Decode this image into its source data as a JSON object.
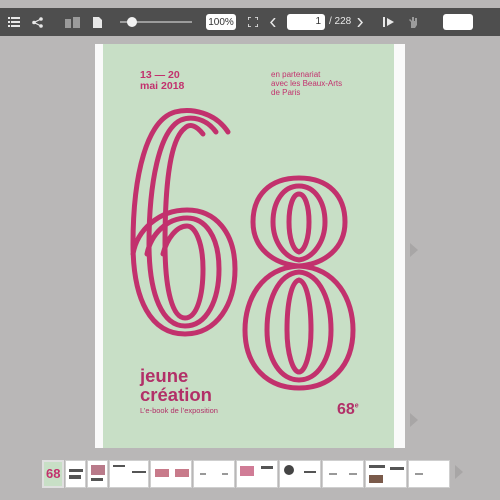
{
  "toolbar": {
    "icons": [
      "menu-icon",
      "share-icon",
      "double-page-icon",
      "single-page-icon",
      "fullscreen-icon",
      "prev-page-icon",
      "next-page-icon",
      "text-select-icon",
      "hand-tool-icon"
    ],
    "zoom": "100%",
    "page_current": "1",
    "page_total": "/ 228",
    "search_value": ""
  },
  "cover": {
    "dates_line1": "13 — 20",
    "dates_line2": "mai 2018",
    "partner_line1": "en partenariat",
    "partner_line2": "avec les Beaux-Arts",
    "partner_line3": "de Paris",
    "big_number_1": "6",
    "big_number_2": "8",
    "title_line1": "jeune",
    "title_line2": "création",
    "subtitle": "L’e-book de l’exposition",
    "edition": "68",
    "edition_suffix": "e",
    "colors": {
      "background": "#c8dfc6",
      "accent": "#b23068"
    }
  },
  "thumbnail_count": 14
}
